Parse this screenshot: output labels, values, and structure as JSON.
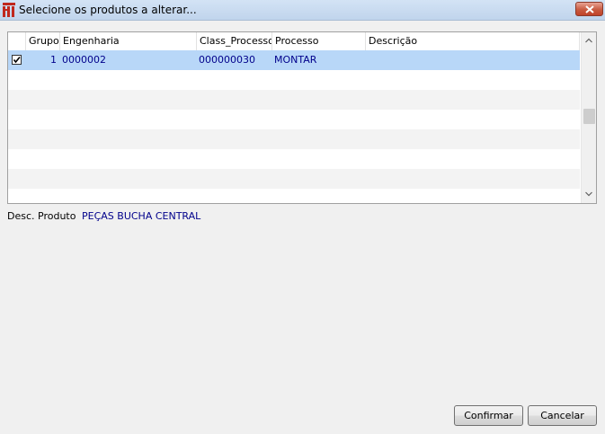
{
  "window": {
    "title": "Selecione os produtos a alterar...",
    "app_icon": "fiat-logo-icon",
    "close_icon": "close-icon"
  },
  "grid": {
    "columns": [
      "",
      "Grupo",
      "Engenharia",
      "Class_Processo",
      "Processo",
      "Descrição"
    ],
    "rows": [
      {
        "checked": true,
        "grupo": "1",
        "engenharia": "0000002",
        "class_processo": "000000030",
        "processo": "MONTAR",
        "descricao": ""
      }
    ],
    "empty_rows": 6
  },
  "details": {
    "desc_produto_label": "Desc. Produto",
    "desc_produto_value": "PEÇAS BUCHA CENTRAL"
  },
  "buttons": {
    "confirm": "Confirmar",
    "cancel": "Cancelar"
  },
  "colors": {
    "selected_row": "#b8d7f8",
    "value_text": "#00008b",
    "close_button": "#c85b41"
  }
}
